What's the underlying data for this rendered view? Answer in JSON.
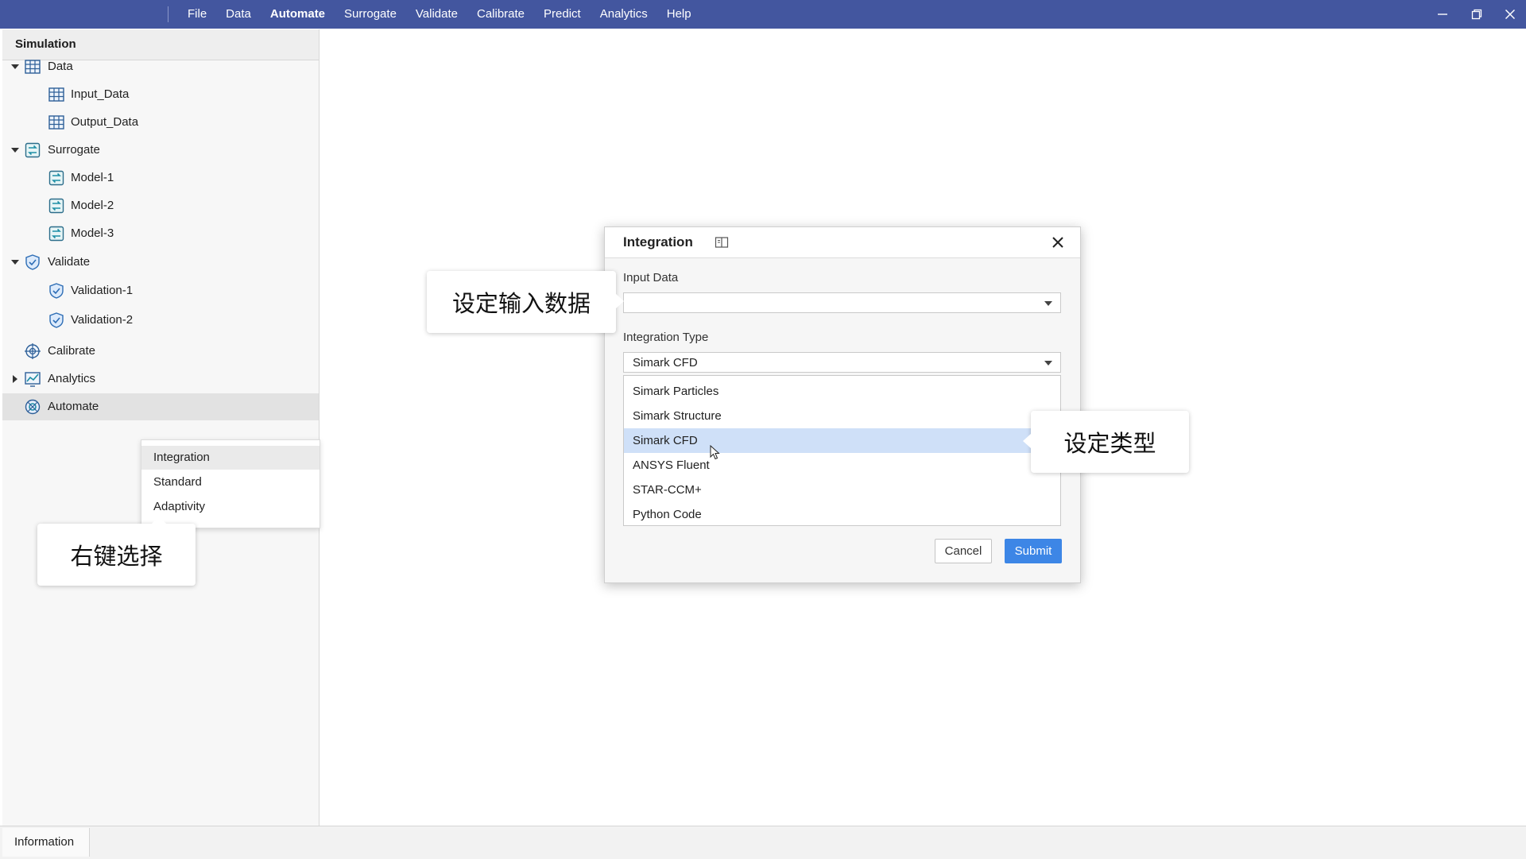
{
  "menubar": {
    "items": [
      "File",
      "Data",
      "Automate",
      "Surrogate",
      "Validate",
      "Calibrate",
      "Predict",
      "Analytics",
      "Help"
    ],
    "active": "Automate",
    "color": "#43569f"
  },
  "panel": {
    "title": "Simulation",
    "tree": [
      {
        "label": "Data",
        "icon": "table-icon",
        "expanded": true
      },
      {
        "label": "Input_Data",
        "icon": "table-icon"
      },
      {
        "label": "Output_Data",
        "icon": "table-icon"
      },
      {
        "label": "Surrogate",
        "icon": "surrogate-icon",
        "expanded": true
      },
      {
        "label": "Model-1",
        "icon": "surrogate-icon"
      },
      {
        "label": "Model-2",
        "icon": "surrogate-icon"
      },
      {
        "label": "Model-3",
        "icon": "surrogate-icon"
      },
      {
        "label": "Validate",
        "icon": "shield-icon",
        "expanded": true
      },
      {
        "label": "Validation-1",
        "icon": "shield-icon"
      },
      {
        "label": "Validation-2",
        "icon": "shield-icon"
      },
      {
        "label": "Calibrate",
        "icon": "crosshair-icon"
      },
      {
        "label": "Analytics",
        "icon": "chart-icon",
        "expanded": false
      },
      {
        "label": "Automate",
        "icon": "automate-icon",
        "selected": true
      }
    ]
  },
  "context_menu": {
    "items": [
      "Integration",
      "Standard",
      "Adaptivity"
    ],
    "hovered": "Integration"
  },
  "callouts": {
    "right_click": "右键选择",
    "input_data": "设定输入数据",
    "type": "设定类型"
  },
  "dialog": {
    "title": "Integration",
    "input_data_label": "Input Data",
    "input_data_value": "",
    "type_label": "Integration Type",
    "type_value": "Simark CFD",
    "options": [
      "Simark Particles",
      "Simark Structure",
      "Simark CFD",
      "ANSYS Fluent",
      "STAR-CCM+",
      "Python Code"
    ],
    "selected_option": "Simark CFD",
    "cancel_label": "Cancel",
    "submit_label": "Submit",
    "submit_color": "#3d86e6"
  },
  "info_bar": {
    "tab_label": "Information"
  }
}
